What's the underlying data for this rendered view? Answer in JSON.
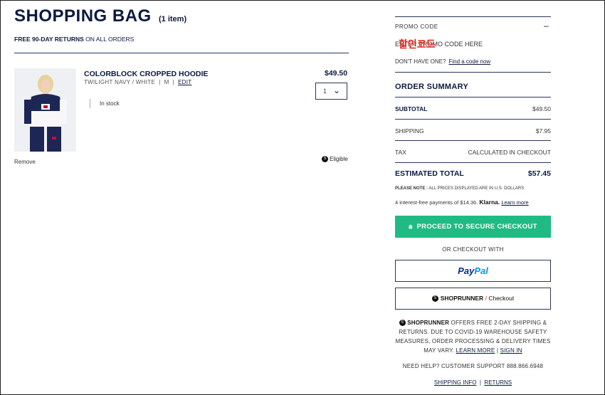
{
  "bag": {
    "title": "SHOPPING BAG",
    "count": "(1 item)",
    "returns_bold": "FREE 90-DAY RETURNS",
    "returns_rest": "ON ALL ORDERS"
  },
  "item": {
    "name": "COLORBLOCK CROPPED HOODIE",
    "color": "TWILIGHT NAVY / WHITE",
    "size": "M",
    "edit": "EDIT",
    "price": "$49.50",
    "qty": "1",
    "stock": "In stock",
    "remove": "Remove",
    "eligible": "Eligible"
  },
  "promo": {
    "label": "PROMO CODE",
    "toggle": "–",
    "placeholder": "ENTER PROMO CODE HERE",
    "overlay_text": "할인코드",
    "dont_have": "DON'T HAVE ONE?",
    "find_link": "Find a code now"
  },
  "summary": {
    "title": "ORDER SUMMARY",
    "subtotal_label": "SUBTOTAL",
    "subtotal_value": "$49.50",
    "shipping_label": "SHIPPING",
    "shipping_value": "$7.95",
    "tax_label": "TAX",
    "tax_value": "CALCULATED IN CHECKOUT",
    "total_label": "ESTIMATED TOTAL",
    "total_value": "$57.45",
    "note_bold": "PLEASE NOTE :",
    "note_rest": "ALL PRICES DISPLAYED ARE IN U.S. DOLLARS",
    "klarna_text": "4 interest-free payments of $14.36.",
    "klarna_brand": "Klarna.",
    "klarna_link": "Learn more"
  },
  "checkout": {
    "secure_button": "PROCEED TO SECURE CHECKOUT",
    "or_text": "OR CHECKOUT WITH",
    "paypal_a": "Pay",
    "paypal_b": "Pal",
    "shoprunner_brand": "SHOPRUNNER",
    "shoprunner_slash": "/",
    "shoprunner_checkout": "Checkout"
  },
  "shoprunner_info": {
    "brand": "SHOPRUNNER",
    "text": "OFFERS FREE 2-DAY SHIPPING & RETURNS. DUE TO COVID-19 WAREHOUSE SAFETY MEASURES, ORDER PROCESSING & DELIVERY TIMES MAY VARY.",
    "learn_more": "LEARN MORE",
    "sign_in": "SIGN IN"
  },
  "help": {
    "text": "NEED HELP? CUSTOMER SUPPORT 888.866.6948"
  },
  "footer": {
    "shipping_info": "SHIPPING INFO",
    "returns": "RETURNS"
  },
  "colors": {
    "navy": "#0c1a40",
    "checkout_green": "#1fbb83",
    "overlay_red": "#e2231a"
  }
}
